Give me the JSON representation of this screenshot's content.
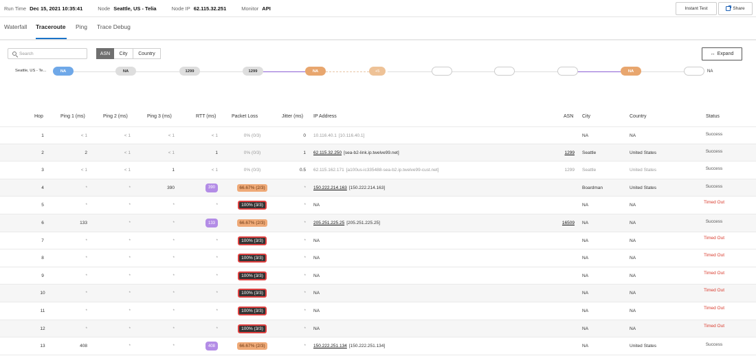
{
  "header": {
    "run_time_label": "Run Time",
    "run_time": "Dec 15, 2021 10:35:41",
    "node_label": "Node",
    "node": "Seattle, US - Telia",
    "node_ip_label": "Node IP",
    "node_ip": "62.115.32.251",
    "monitor_label": "Monitor",
    "monitor": "API",
    "instant_test_label": "Instant Test",
    "share_label": "Share"
  },
  "tabs": [
    "Waterfall",
    "Traceroute",
    "Ping",
    "Trace Debug"
  ],
  "active_tab": "Traceroute",
  "controls": {
    "search_placeholder": "Search",
    "group_by": [
      "ASN",
      "City",
      "Country"
    ],
    "active_group": "ASN",
    "expand_label": "Expand",
    "expand_icon": "arrows-horizontal-icon"
  },
  "path_graph": {
    "origin_label": "Seattle, US - Te...",
    "nodes": [
      "NA",
      "NA",
      "1299",
      "1299",
      "NA",
      "+5",
      "",
      "",
      "",
      "NA",
      ""
    ],
    "end_label": "NA"
  },
  "table": {
    "columns": [
      "Hop",
      "Ping 1 (ms)",
      "Ping 2 (ms)",
      "Ping 3 (ms)",
      "RTT (ms)",
      "Packet Loss",
      "Jitter (ms)",
      "IP Address",
      "ASN",
      "City",
      "Country",
      "Status"
    ],
    "rows": [
      {
        "hop": "1",
        "ping1": "< 1",
        "ping2": "< 1",
        "ping3": "< 1",
        "rtt": "< 1",
        "loss": "0% (0/3)",
        "jitter": "0",
        "ip": "10.116.40.1",
        "ip_paren": "[10.116.40.1]",
        "asn": "",
        "city": "NA",
        "country": "NA",
        "status": "Success"
      },
      {
        "hop": "2",
        "ping1": "2",
        "ping2": "< 1",
        "ping3": "< 1",
        "rtt": "1",
        "loss": "0% (0/3)",
        "jitter": "1",
        "ip": "62.115.32.250",
        "ip_paren": "[sea-b2-link.ip.twelve99.net]",
        "asn": "1299",
        "city": "Seattle",
        "country": "United States",
        "status": "Success"
      },
      {
        "hop": "3",
        "ping1": "< 1",
        "ping2": "< 1",
        "ping3": "1",
        "rtt": "< 1",
        "loss": "0% (0/3)",
        "jitter": "0.5",
        "ip": "62.115.162.171",
        "ip_paren": "[a100us-ic335488-sea-b2.ip.twelve99-cust.net]",
        "asn": "1299",
        "city": "Seattle",
        "country": "United States",
        "status": "Success"
      },
      {
        "hop": "4",
        "ping1": "*",
        "ping2": "*",
        "ping3": "390",
        "rtt": "390",
        "loss": "66.67% (2/3)",
        "jitter": "*",
        "ip": "150.222.214.163",
        "ip_paren": "[150.222.214.163]",
        "asn": "",
        "city": "Boardman",
        "country": "United States",
        "status": "Success"
      },
      {
        "hop": "5",
        "ping1": "*",
        "ping2": "*",
        "ping3": "*",
        "rtt": "*",
        "loss": "100% (3/3)",
        "jitter": "*",
        "ip": "NA",
        "ip_paren": "",
        "asn": "",
        "city": "NA",
        "country": "NA",
        "status": "Timed Out"
      },
      {
        "hop": "6",
        "ping1": "133",
        "ping2": "*",
        "ping3": "*",
        "rtt": "133",
        "loss": "66.67% (2/3)",
        "jitter": "*",
        "ip": "205.251.225.25",
        "ip_paren": "[205.251.225.25]",
        "asn": "16509",
        "city": "NA",
        "country": "NA",
        "status": "Success"
      },
      {
        "hop": "7",
        "ping1": "*",
        "ping2": "*",
        "ping3": "*",
        "rtt": "*",
        "loss": "100% (3/3)",
        "jitter": "*",
        "ip": "NA",
        "ip_paren": "",
        "asn": "",
        "city": "NA",
        "country": "NA",
        "status": "Timed Out"
      },
      {
        "hop": "8",
        "ping1": "*",
        "ping2": "*",
        "ping3": "*",
        "rtt": "*",
        "loss": "100% (3/3)",
        "jitter": "*",
        "ip": "NA",
        "ip_paren": "",
        "asn": "",
        "city": "NA",
        "country": "NA",
        "status": "Timed Out"
      },
      {
        "hop": "9",
        "ping1": "*",
        "ping2": "*",
        "ping3": "*",
        "rtt": "*",
        "loss": "100% (3/3)",
        "jitter": "*",
        "ip": "NA",
        "ip_paren": "",
        "asn": "",
        "city": "NA",
        "country": "NA",
        "status": "Timed Out"
      },
      {
        "hop": "10",
        "ping1": "*",
        "ping2": "*",
        "ping3": "*",
        "rtt": "*",
        "loss": "100% (3/3)",
        "jitter": "*",
        "ip": "NA",
        "ip_paren": "",
        "asn": "",
        "city": "NA",
        "country": "NA",
        "status": "Timed Out"
      },
      {
        "hop": "11",
        "ping1": "*",
        "ping2": "*",
        "ping3": "*",
        "rtt": "*",
        "loss": "100% (3/3)",
        "jitter": "*",
        "ip": "NA",
        "ip_paren": "",
        "asn": "",
        "city": "NA",
        "country": "NA",
        "status": "Timed Out"
      },
      {
        "hop": "12",
        "ping1": "*",
        "ping2": "*",
        "ping3": "*",
        "rtt": "*",
        "loss": "100% (3/3)",
        "jitter": "*",
        "ip": "NA",
        "ip_paren": "",
        "asn": "",
        "city": "NA",
        "country": "NA",
        "status": "Timed Out"
      },
      {
        "hop": "13",
        "ping1": "408",
        "ping2": "*",
        "ping3": "*",
        "rtt": "408",
        "loss": "66.67% (2/3)",
        "jitter": "*",
        "ip": "150.222.251.134",
        "ip_paren": "[150.222.251.134]",
        "asn": "",
        "city": "NA",
        "country": "United States",
        "status": "Success"
      }
    ]
  }
}
